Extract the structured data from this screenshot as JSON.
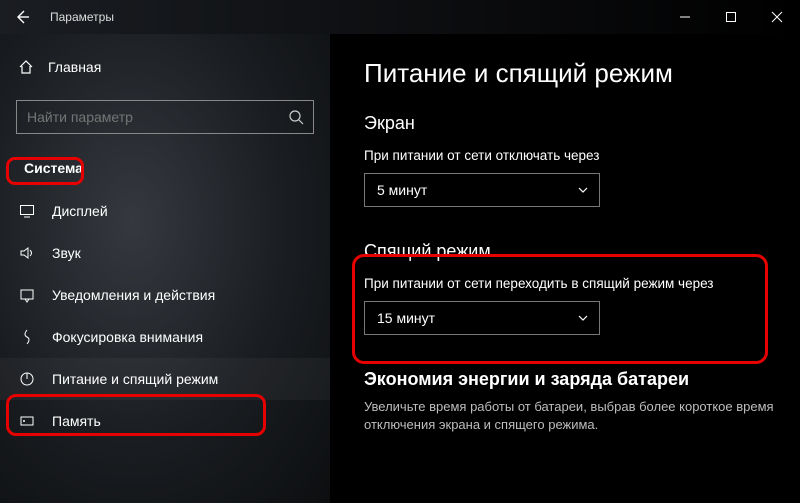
{
  "titlebar": {
    "title": "Параметры"
  },
  "sidebar": {
    "home": "Главная",
    "search_placeholder": "Найти параметр",
    "category": "Система",
    "items": [
      {
        "label": "Дисплей"
      },
      {
        "label": "Звук"
      },
      {
        "label": "Уведомления и действия"
      },
      {
        "label": "Фокусировка внимания"
      },
      {
        "label": "Питание и спящий режим"
      },
      {
        "label": "Память"
      }
    ]
  },
  "main": {
    "page_title": "Питание и спящий режим",
    "screen": {
      "title": "Экран",
      "label": "При питании от сети отключать через",
      "value": "5 минут"
    },
    "sleep": {
      "title": "Спящий режим",
      "label": "При питании от сети переходить в спящий режим через",
      "value": "15 минут"
    },
    "battery": {
      "title": "Экономия энергии и заряда батареи",
      "desc": "Увеличьте время работы от батареи, выбрав более короткое время отключения экрана и спящего режима."
    }
  }
}
